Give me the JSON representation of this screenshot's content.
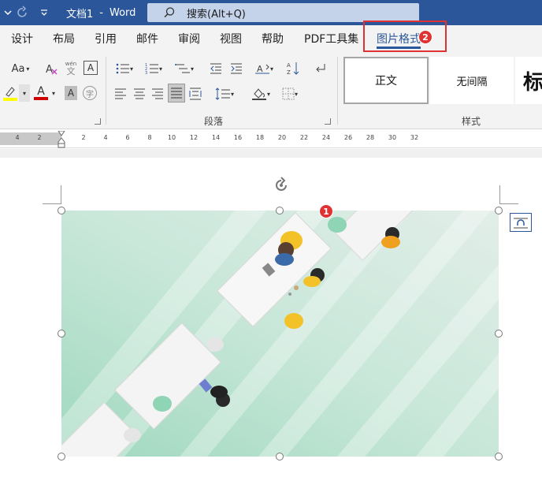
{
  "titlebar": {
    "doc_name": "文档1",
    "separator": "-",
    "app_name": "Word",
    "search_placeholder": "搜索(Alt+Q)"
  },
  "tabs": [
    "设计",
    "布局",
    "引用",
    "邮件",
    "审阅",
    "视图",
    "帮助",
    "PDF工具集",
    "图片格式"
  ],
  "active_tab": "图片格式",
  "callouts": {
    "tab_badge": "2",
    "image_badge": "1"
  },
  "ribbon": {
    "font_size_button": "Aa",
    "wen_phonetic": "wén",
    "wen_char": "文",
    "char_border": "A",
    "char_shading": "A",
    "enclose_char": "字",
    "paragraph_group": "段落",
    "styles_group": "样式",
    "styles": [
      "正文",
      "无间隔",
      "标"
    ]
  },
  "ruler": {
    "left_marks": [
      "4",
      "2"
    ],
    "right_marks": [
      "2",
      "4",
      "6",
      "8",
      "10",
      "12",
      "14",
      "16",
      "18",
      "20",
      "22",
      "24",
      "26",
      "28",
      "30",
      "32"
    ]
  },
  "colors": {
    "title_blue": "#2b579a",
    "callout_red": "#e03232",
    "highlight_yellow": "#ffff00",
    "font_red": "#d00000"
  }
}
